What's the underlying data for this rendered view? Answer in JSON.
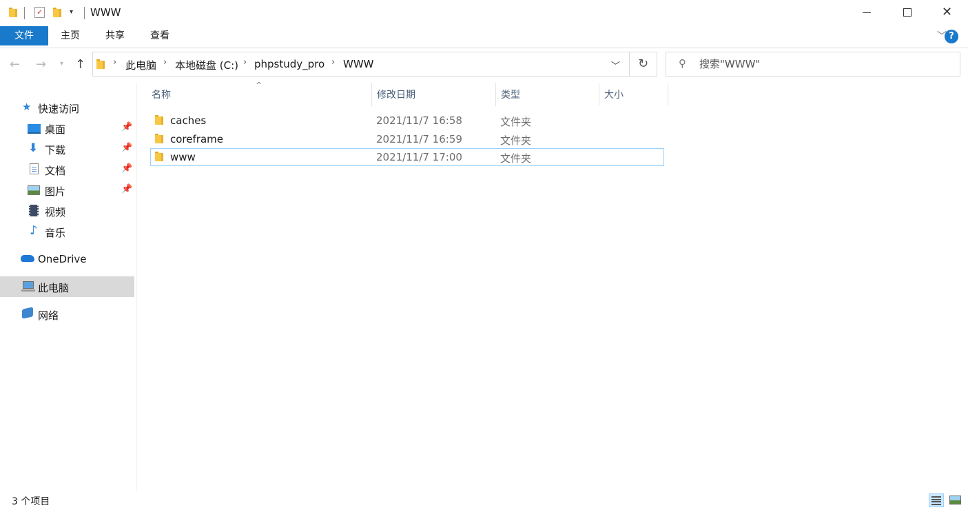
{
  "window": {
    "title": "WWW",
    "minimize_glyph": "—",
    "maximize_glyph": "☐",
    "close_glyph": "✕"
  },
  "ribbon": {
    "tabs": [
      {
        "label": "文件"
      },
      {
        "label": "主页"
      },
      {
        "label": "共享"
      },
      {
        "label": "查看"
      }
    ],
    "help_label": "?"
  },
  "address": {
    "crumbs": [
      "此电脑",
      "本地磁盘 (C:)",
      "phpstudy_pro",
      "WWW"
    ]
  },
  "search": {
    "placeholder": "搜索\"WWW\""
  },
  "sidebar": {
    "items": [
      {
        "label": "快速访问",
        "icon": "star-icon"
      },
      {
        "label": "桌面",
        "icon": "desktop-icon",
        "pinned": true
      },
      {
        "label": "下载",
        "icon": "download-icon",
        "pinned": true
      },
      {
        "label": "文档",
        "icon": "document-icon",
        "pinned": true
      },
      {
        "label": "图片",
        "icon": "pictures-icon",
        "pinned": true
      },
      {
        "label": "视频",
        "icon": "video-icon"
      },
      {
        "label": "音乐",
        "icon": "music-icon"
      },
      {
        "label": "OneDrive",
        "icon": "cloud-icon"
      },
      {
        "label": "此电脑",
        "icon": "computer-icon",
        "selected": true
      },
      {
        "label": "网络",
        "icon": "network-icon"
      }
    ]
  },
  "table": {
    "columns": [
      "名称",
      "修改日期",
      "类型",
      "大小"
    ],
    "rows": [
      {
        "name": "caches",
        "modified": "2021/11/7 16:58",
        "type": "文件夹",
        "size": ""
      },
      {
        "name": "coreframe",
        "modified": "2021/11/7 16:59",
        "type": "文件夹",
        "size": ""
      },
      {
        "name": "www",
        "modified": "2021/11/7 17:00",
        "type": "文件夹",
        "size": "",
        "selected": true
      }
    ]
  },
  "status": {
    "item_count": "3 个项目"
  },
  "colors": {
    "accent": "#1979ca",
    "selection_border": "#99d1ff",
    "sidebar_selected": "#d9d9d9",
    "folder": "#f8c744"
  }
}
